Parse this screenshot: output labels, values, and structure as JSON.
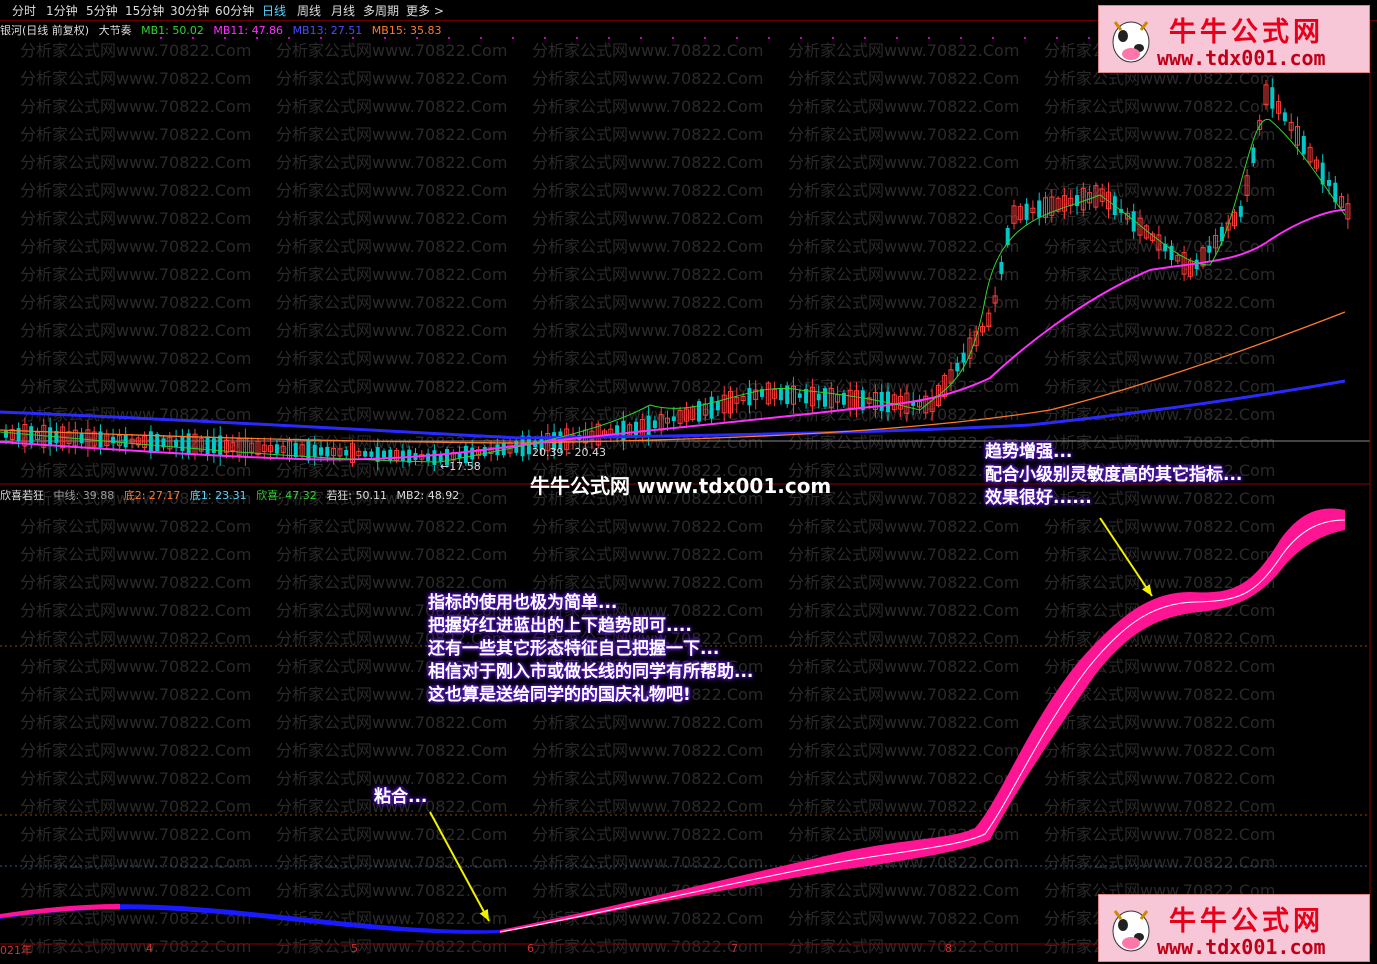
{
  "toolbar": {
    "periods": [
      "分时",
      "1分钟",
      "5分钟",
      "15分钟",
      "30分钟",
      "60分钟",
      "日线",
      "周线",
      "月线",
      "多周期",
      "更多 >"
    ],
    "active": "日线"
  },
  "main_info": {
    "stock": "银河(日线 前复权)",
    "indicator": "大节奏",
    "mb1": "MB1: 50.02",
    "mb11": "MB11: 47.86",
    "mb13": "MB13: 27.51",
    "mb15": "MB15: 35.83"
  },
  "sub_info": {
    "name": "欣喜若狂",
    "mid": "中线: 39.88",
    "di2": "底2: 27.17",
    "di1": "底1: 23.31",
    "xinxi": "欣喜: 47.32",
    "ruokuang": "若狂: 50.11",
    "mb2": "MB2: 48.92"
  },
  "price_labels": {
    "low": "←17.58",
    "range": "20.39 - 20.43"
  },
  "x_axis": [
    "021年",
    "4",
    "5",
    "6",
    "7",
    "8"
  ],
  "watermark": "分析家公式网www.70822.Com",
  "brand": {
    "name": "牛牛公式网",
    "url": "www.tdx001.com",
    "mid_text": "牛牛公式网 www.tdx001.com"
  },
  "annotations": {
    "a1": [
      "指标的使用也极为简单...",
      "把握好红进蓝出的上下趋势即可....",
      "还有一些其它形态特征自己把握一下...",
      "相信对于刚入市或做长线的同学有所帮助...",
      "这也算是送给同学的的国庆礼物吧!"
    ],
    "a2": "粘合...",
    "a3": [
      "趋势增强...",
      "配合小级别灵敏度高的其它指标...",
      "效果很好......"
    ]
  },
  "colors": {
    "up": "#ff3c3c",
    "down": "#00c8c8",
    "ma_green": "#2ed62e",
    "ma_magenta": "#ff2fff",
    "ma_orange": "#ff7a2a",
    "ma_blue": "#2a2aff",
    "ribbon_pink": "#ff1493",
    "ribbon_blue": "#1a1aff"
  },
  "chart_data": {
    "type": "line",
    "title": "",
    "main_panel": {
      "series": [
        {
          "name": "MB1",
          "color": "#2ed62e",
          "values": [
            50.02
          ]
        },
        {
          "name": "MB11",
          "color": "#ff2fff",
          "values": [
            47.86
          ]
        },
        {
          "name": "MB13",
          "color": "#2a2aff",
          "values": [
            27.51
          ]
        },
        {
          "name": "MB15",
          "color": "#ff7a2a",
          "values": [
            35.83
          ]
        }
      ],
      "marked_low": 17.58,
      "marked_range": [
        20.39,
        20.43
      ]
    },
    "sub_panel": {
      "series": [
        {
          "name": "中线",
          "values": [
            39.88
          ]
        },
        {
          "name": "底2",
          "values": [
            27.17
          ]
        },
        {
          "name": "底1",
          "values": [
            23.31
          ]
        },
        {
          "name": "欣喜",
          "values": [
            47.32
          ]
        },
        {
          "name": "若狂",
          "values": [
            50.11
          ]
        },
        {
          "name": "MB2",
          "values": [
            48.92
          ]
        }
      ]
    },
    "categories": [
      "021年",
      "4",
      "5",
      "6",
      "7",
      "8"
    ]
  }
}
